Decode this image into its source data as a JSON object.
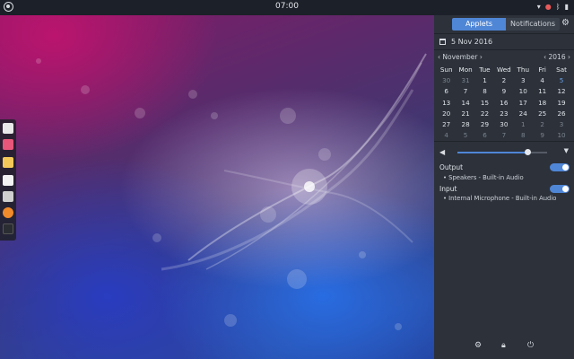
{
  "topbar": {
    "clock": "07:00",
    "tray_icons": [
      "network-icon",
      "notification-icon",
      "bluetooth-icon",
      "battery-icon"
    ]
  },
  "dock": {
    "apps": [
      {
        "name": "music-app-icon",
        "color": "#e8e8e8"
      },
      {
        "name": "photos-app-icon",
        "color": "#e8567a"
      },
      {
        "name": "notes-app-icon",
        "color": "#f4c95a"
      },
      {
        "name": "calendar-app-icon",
        "color": "#f2f2f2"
      },
      {
        "name": "video-player-icon",
        "color": "#cfcfcf"
      },
      {
        "name": "firefox-icon",
        "color": "#f08a2a"
      },
      {
        "name": "terminal-icon",
        "color": "#2a2d32"
      }
    ]
  },
  "panel": {
    "tabs": {
      "applets": "Applets",
      "notifications": "Notifications"
    },
    "date": "5 Nov 2016",
    "calendar": {
      "month": "November",
      "year": "2016",
      "weekdays": [
        "Sun",
        "Mon",
        "Tue",
        "Wed",
        "Thu",
        "Fri",
        "Sat"
      ],
      "weeks": [
        [
          "30",
          "31",
          "1",
          "2",
          "3",
          "4",
          "5"
        ],
        [
          "6",
          "7",
          "8",
          "9",
          "10",
          "11",
          "12"
        ],
        [
          "13",
          "14",
          "15",
          "16",
          "17",
          "18",
          "19"
        ],
        [
          "20",
          "21",
          "22",
          "23",
          "24",
          "25",
          "26"
        ],
        [
          "27",
          "28",
          "29",
          "30",
          "1",
          "2",
          "3"
        ],
        [
          "4",
          "5",
          "6",
          "7",
          "8",
          "9",
          "10"
        ]
      ]
    },
    "volume": {
      "level": 0.78
    },
    "output": {
      "label": "Output",
      "device": "Speakers - Built-in Audio",
      "enabled": true
    },
    "input": {
      "label": "Input",
      "device": "Internal Microphone - Built-in Audio",
      "enabled": true
    },
    "accent": "#4f86d6"
  }
}
